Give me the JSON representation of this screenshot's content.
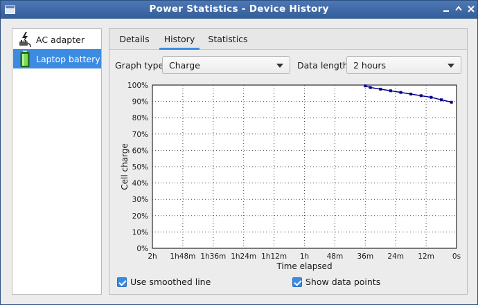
{
  "window": {
    "title": "Power Statistics - Device History",
    "controls": [
      "minimize",
      "maximize",
      "close"
    ]
  },
  "devices": [
    {
      "label": "AC adapter",
      "icon": "ac-adapter-icon",
      "selected": false
    },
    {
      "label": "Laptop battery",
      "icon": "battery-icon",
      "selected": true
    }
  ],
  "tabs": [
    {
      "label": "Details",
      "active": false
    },
    {
      "label": "History",
      "active": true
    },
    {
      "label": "Statistics",
      "active": false
    }
  ],
  "controls": {
    "graph_type_label": "Graph type:",
    "graph_type_value": "Charge",
    "data_length_label": "Data length:",
    "data_length_value": "2 hours"
  },
  "options": {
    "smoothed_line": "Use smoothed line",
    "show_points": "Show data points"
  },
  "colors": {
    "accent": "#3b8be2",
    "series": "#00008b"
  },
  "chart_data": {
    "type": "line",
    "xlabel": "Time elapsed",
    "ylabel": "Cell charge",
    "x_tick_labels": [
      "2h",
      "1h48m",
      "1h36m",
      "1h24m",
      "1h12m",
      "1h",
      "48m",
      "36m",
      "24m",
      "12m",
      "0s"
    ],
    "y_tick_labels": [
      "0%",
      "10%",
      "20%",
      "30%",
      "40%",
      "50%",
      "60%",
      "70%",
      "80%",
      "90%",
      "100%"
    ],
    "xlim_minutes_ago": [
      120,
      0
    ],
    "ylim": [
      0,
      100
    ],
    "grid": true,
    "series": [
      {
        "points": [
          {
            "minutes_ago": 36,
            "charge": 99.5
          },
          {
            "minutes_ago": 34,
            "charge": 98.5
          },
          {
            "minutes_ago": 30,
            "charge": 97.5
          },
          {
            "minutes_ago": 26,
            "charge": 96.5
          },
          {
            "minutes_ago": 22,
            "charge": 95.5
          },
          {
            "minutes_ago": 18,
            "charge": 94.5
          },
          {
            "minutes_ago": 14,
            "charge": 93.5
          },
          {
            "minutes_ago": 10,
            "charge": 92.5
          },
          {
            "minutes_ago": 6,
            "charge": 91.0
          },
          {
            "minutes_ago": 2,
            "charge": 89.5
          }
        ]
      }
    ]
  }
}
